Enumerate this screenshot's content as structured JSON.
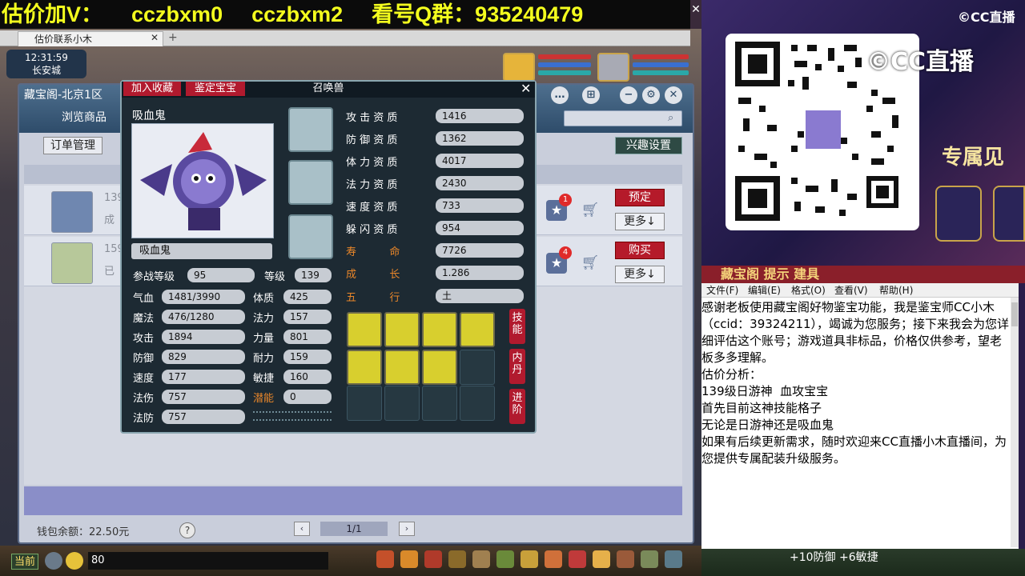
{
  "banner": {
    "part1": "估价加V：",
    "part2": "cczbxm0",
    "part3": "cczbxm2",
    "part4": "看号Q群：935240479"
  },
  "browser": {
    "tab_title": "估价联系小木",
    "close": "✕",
    "new_tab": "+"
  },
  "game_hud": {
    "time": "12:31:59",
    "location": "长安城"
  },
  "shop": {
    "title": "藏宝阁-北京1区",
    "browse_label": "浏览商品",
    "orders_label": "订单管理",
    "interest_label": "兴趣设置",
    "items": [
      {
        "prefix": "139",
        "status": "成",
        "badge": "1",
        "action": "预定",
        "more": "更多↓"
      },
      {
        "prefix": "159",
        "status": "已",
        "badge": "4",
        "action": "购买",
        "more": "更多↓"
      }
    ],
    "wallet": "钱包余额：22.50元",
    "help": "?",
    "page": "1/1",
    "prev": "‹",
    "next": "›"
  },
  "bottom_bar": {
    "channel": "当前",
    "chat_value": "80"
  },
  "pet_panel": {
    "add_fav": "加入收藏",
    "appraise": "鉴定宝宝",
    "title": "召唤兽",
    "close": "✕",
    "pet_name": "吸血鬼",
    "pet_name_field": "吸血鬼",
    "battle_level_label": "参战等级",
    "battle_level": "95",
    "level_label": "等级",
    "level": "139",
    "stats_left": [
      {
        "label": "气血",
        "value": "1481/3990"
      },
      {
        "label": "魔法",
        "value": "476/1280"
      },
      {
        "label": "攻击",
        "value": "1894"
      },
      {
        "label": "防御",
        "value": "829"
      },
      {
        "label": "速度",
        "value": "177"
      },
      {
        "label": "法伤",
        "value": "757"
      },
      {
        "label": "法防",
        "value": "757"
      }
    ],
    "stats_mid": [
      {
        "label": "体质",
        "value": "425"
      },
      {
        "label": "法力",
        "value": "157"
      },
      {
        "label": "力量",
        "value": "801"
      },
      {
        "label": "耐力",
        "value": "159"
      },
      {
        "label": "敏捷",
        "value": "160"
      },
      {
        "label": "潜能",
        "value": "0"
      }
    ],
    "aptitudes": [
      {
        "label": "攻 击 资 质",
        "value": "1416"
      },
      {
        "label": "防 御 资 质",
        "value": "1362"
      },
      {
        "label": "体 力 资 质",
        "value": "4017"
      },
      {
        "label": "法 力 资 质",
        "value": "2430"
      },
      {
        "label": "速 度 资 质",
        "value": "733"
      },
      {
        "label": "躲 闪 资 质",
        "value": "954"
      }
    ],
    "extra": [
      {
        "label": "寿          命",
        "value": "7726"
      },
      {
        "label": "成          长",
        "value": "1.286"
      },
      {
        "label": "五          行",
        "value": "土"
      }
    ],
    "side_skill": "技能",
    "side_neidan": "内丹",
    "side_advance": "进阶"
  },
  "right_panel": {
    "cc_logo": "©CC直播",
    "qr_watermark": "©CC直播",
    "exclusive": "专属见",
    "promo": "藏宝阁 提示 建具",
    "notepad_menu": [
      "文件(F)",
      "编辑(E)",
      "格式(O)",
      "查看(V)",
      "帮助(H)"
    ],
    "notepad_text": "感谢老板使用藏宝阁好物鉴宝功能，我是鉴宝师CC小木（ccid：39324211），竭诚为您服务；接下来我会为您详细评估这个账号；游戏道具非标品，价格仅供参考，望老板多多理解。\n估价分析：\n139级日游神  血攻宝宝\n首先目前这神技能格子\n无论是日游神还是吸血鬼\n如果有后续更新需求，随时欢迎来CC直播小木直播间，为您提供专属配装升级服务。",
    "buff_text": "+10防御 +6敏捷"
  },
  "colors": {
    "banner_text": "#f4ff1e",
    "accent_red": "#b11a2e",
    "stat_orange": "#e8862a"
  }
}
